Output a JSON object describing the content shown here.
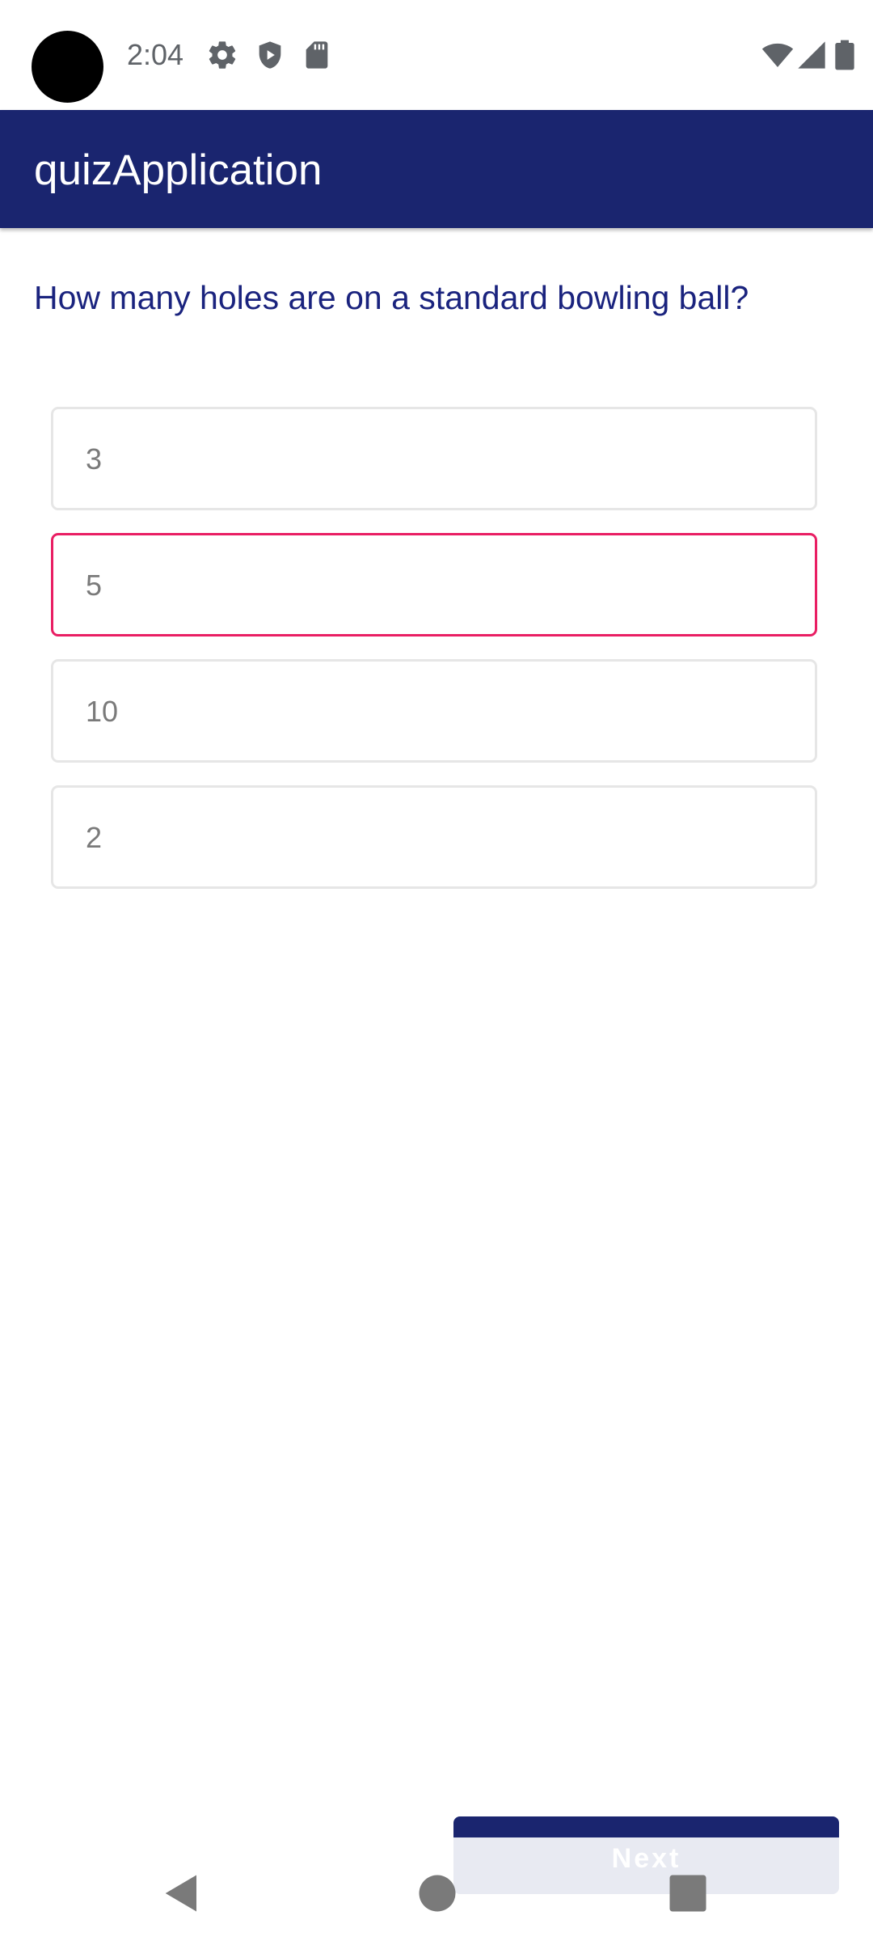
{
  "status_bar": {
    "time": "2:04",
    "left_icons": [
      "settings-icon",
      "shield-play-icon",
      "sd-card-icon"
    ],
    "right_icons": [
      "wifi-icon",
      "signal-icon",
      "battery-icon"
    ]
  },
  "app_bar": {
    "title": "quizApplication",
    "color": "#1a256f"
  },
  "quiz": {
    "question": "How many holes are on a standard bowling ball?",
    "options": [
      {
        "label": "3",
        "selected": false
      },
      {
        "label": "5",
        "selected": true
      },
      {
        "label": "10",
        "selected": false
      },
      {
        "label": "2",
        "selected": false
      }
    ],
    "selected_color": "#e91e63",
    "question_color": "#1a237e"
  },
  "next_button": {
    "label": "Next"
  },
  "nav_bar": {
    "buttons": [
      "back-icon",
      "home-icon",
      "recents-icon"
    ]
  }
}
